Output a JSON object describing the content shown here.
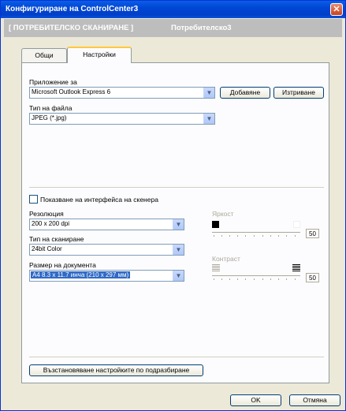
{
  "window": {
    "title": "Конфигуриране на ControlCenter3",
    "close_glyph": "✕"
  },
  "header": {
    "section": "[ ПОТРЕБИТЕЛСКО СКАНИРАНЕ ]",
    "name": "Потребителско3"
  },
  "tabs": [
    {
      "label": "Общи"
    },
    {
      "label": "Настройки"
    }
  ],
  "application": {
    "label": "Приложение за",
    "value": "Microsoft Outlook Express 6",
    "add_button": "Добавяне",
    "remove_button": "Изтриване"
  },
  "file_type": {
    "label": "Тип на файла",
    "value": "JPEG (*.jpg)"
  },
  "scanner_interface": {
    "label": "Показване на интерфейса на скенера",
    "checked": false
  },
  "resolution": {
    "label": "Резолюция",
    "value": "200 x 200 dpi"
  },
  "scan_type": {
    "label": "Тип на сканиране",
    "value": "24bit Color"
  },
  "document_size": {
    "label": "Размер на документа",
    "value": "A4 8.3 x 11.7 инча (210 x 297 мм)"
  },
  "brightness": {
    "label": "Яркост",
    "value": "50"
  },
  "contrast": {
    "label": "Контраст",
    "value": "50"
  },
  "restore_button": "Възстановяване настройките по подразбиране",
  "ok_button": "OK",
  "cancel_button": "Отмяна"
}
